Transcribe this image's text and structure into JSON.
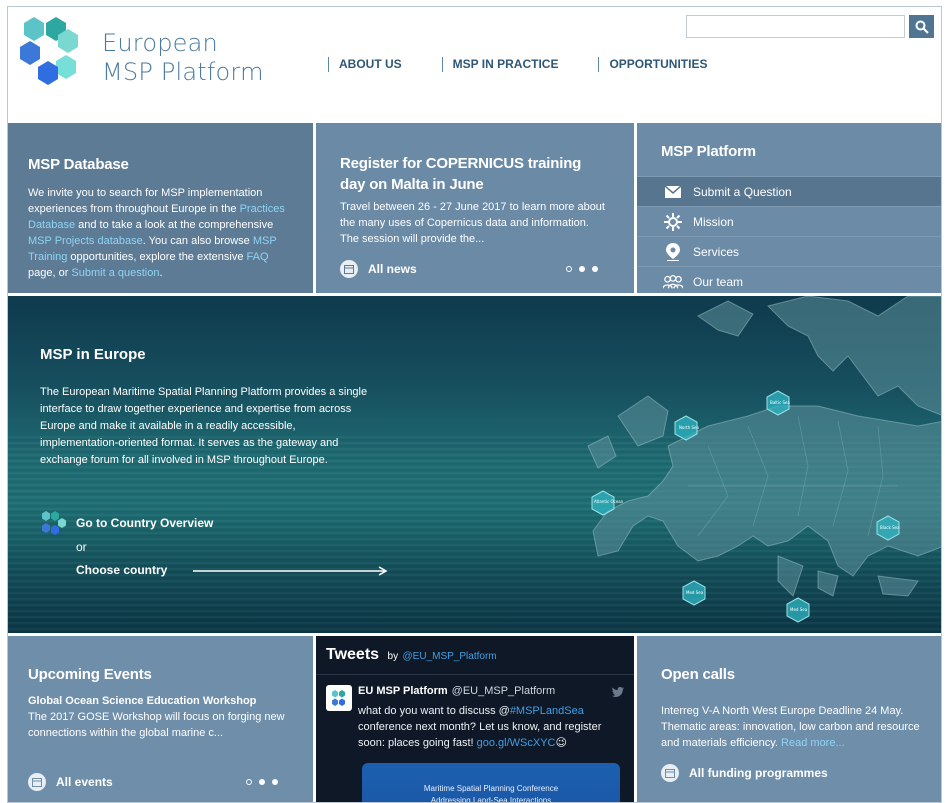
{
  "brand": {
    "line1": "European",
    "line2": "MSP Platform"
  },
  "nav": [
    {
      "label": "ABOUT US"
    },
    {
      "label": "MSP IN PRACTICE"
    },
    {
      "label": "OPPORTUNITIES"
    }
  ],
  "search": {
    "placeholder": ""
  },
  "database": {
    "title": "MSP Database",
    "t1": "We invite you to search for MSP implementation experiences from throughout Europe in the ",
    "l1": "Practices Database",
    "t2": " and to take a look at the comprehensive ",
    "l2": "MSP Projects database",
    "t3": ". You can also browse ",
    "l3": "MSP Training",
    "t4": " opportunities, explore the extensive ",
    "l4": "FAQ",
    "t5": " page, or ",
    "l5": "Submit a question",
    "t6": "."
  },
  "news": {
    "title": "Register for COPERNICUS training day on Malta in June",
    "text": "Travel between 26 - 27 June 2017 to learn more about the many uses of Copernicus data and information. The session will provide the...",
    "all_label": "All news"
  },
  "platform": {
    "title": "MSP Platform",
    "items": [
      {
        "label": "Submit a Question",
        "icon": "envelope-icon"
      },
      {
        "label": "Mission",
        "icon": "gear-icon"
      },
      {
        "label": "Services",
        "icon": "map-pin-icon"
      },
      {
        "label": "Our team",
        "icon": "people-icon"
      }
    ]
  },
  "hero": {
    "title": "MSP in Europe",
    "text": "The European Maritime Spatial Planning Platform provides a single interface to draw together experience and expertise from across Europe and make it available in a readily accessible, implementation-oriented format. It serves as the gateway and exchange forum for all involved in MSP throughout Europe.",
    "cta": "Go to Country Overview",
    "or": "or",
    "choose": "Choose country",
    "sea_labels": [
      "North Sea",
      "Baltic Sea",
      "Atlantic Ocean",
      "Black Sea",
      "Med Sea",
      "Med Sea"
    ]
  },
  "events": {
    "title": "Upcoming Events",
    "event_title": "Global Ocean Science Education Workshop",
    "event_text": "The 2017 GOSE Workshop will focus on forging new connections within the global marine c...",
    "all_label": "All events"
  },
  "tweets": {
    "heading": "Tweets",
    "by": "by",
    "handle": "@EU_MSP_Platform",
    "name": "EU MSP Platform",
    "name_handle": "@EU_MSP_Platform",
    "text1": "what do you want to discuss @",
    "hashtag": "#MSPLandSea",
    "text2": " conference next month? Let us know, and register soon: places going fast! ",
    "url": "goo.gl/WScXYC",
    "emoji": "😉",
    "card_line1": "Maritime Spatial Planning Conference",
    "card_line2": "Addressing Land-Sea Interactions"
  },
  "calls": {
    "title": "Open calls",
    "text": "Interreg V-A North West Europe Deadline 24 May. Thematic areas: innovation, low carbon and resource and materials efficiency. ",
    "more": "Read more...",
    "all_label": "All funding programmes"
  },
  "colors": {
    "accent": "#4a7aa0",
    "panel": "#6f8eaa",
    "link": "#8fd4f5",
    "tweet_bg": "#0f1827"
  }
}
